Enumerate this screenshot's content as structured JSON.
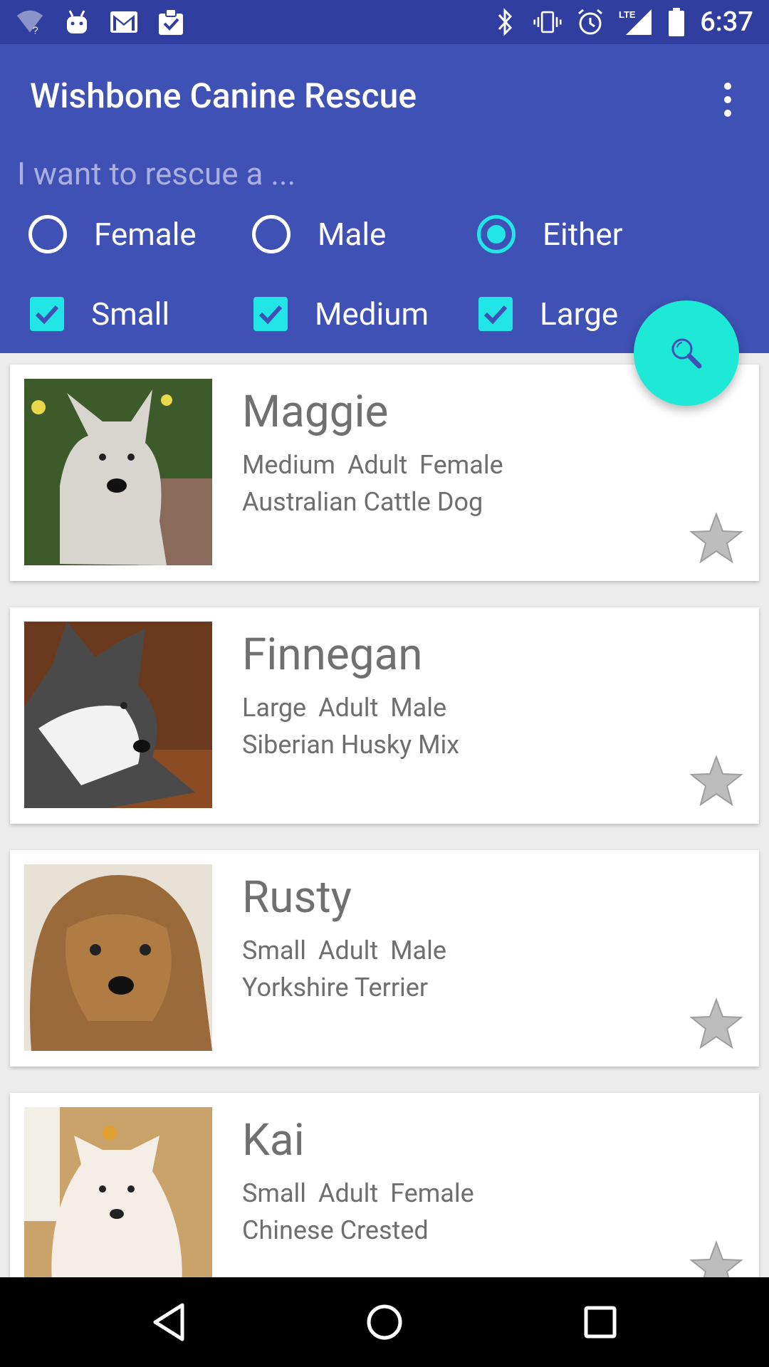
{
  "status_bar": {
    "time": "6:37",
    "icons_left": [
      "wifi-unknown-icon",
      "android-icon",
      "gmail-icon",
      "clipboard-check-icon"
    ],
    "icons_right": [
      "bluetooth-icon",
      "vibrate-icon",
      "alarm-icon",
      "lte-signal-icon",
      "battery-icon"
    ],
    "lte_label": "LTE"
  },
  "app_bar": {
    "title": "Wishbone Canine Rescue",
    "subtitle": "I want to rescue a ...",
    "gender_options": [
      {
        "label": "Female",
        "checked": false
      },
      {
        "label": "Male",
        "checked": false
      },
      {
        "label": "Either",
        "checked": true
      }
    ],
    "size_options": [
      {
        "label": "Small",
        "checked": true
      },
      {
        "label": "Medium",
        "checked": true
      },
      {
        "label": "Large",
        "checked": true
      }
    ]
  },
  "colors": {
    "status_bar": "#303f9f",
    "primary": "#3f51b5",
    "accent": "#1de9d6",
    "text_secondary": "#6e6e6e"
  },
  "dogs": [
    {
      "name": "Maggie",
      "size": "Medium",
      "age": "Adult",
      "sex": "Female",
      "breed": "Australian Cattle Dog"
    },
    {
      "name": "Finnegan",
      "size": "Large",
      "age": "Adult",
      "sex": "Male",
      "breed": "Siberian Husky Mix"
    },
    {
      "name": "Rusty",
      "size": "Small",
      "age": "Adult",
      "sex": "Male",
      "breed": "Yorkshire Terrier"
    },
    {
      "name": "Kai",
      "size": "Small",
      "age": "Adult",
      "sex": "Female",
      "breed": "Chinese Crested"
    }
  ],
  "nav_bar": {
    "buttons": [
      "back-icon",
      "home-icon",
      "recents-icon"
    ]
  }
}
